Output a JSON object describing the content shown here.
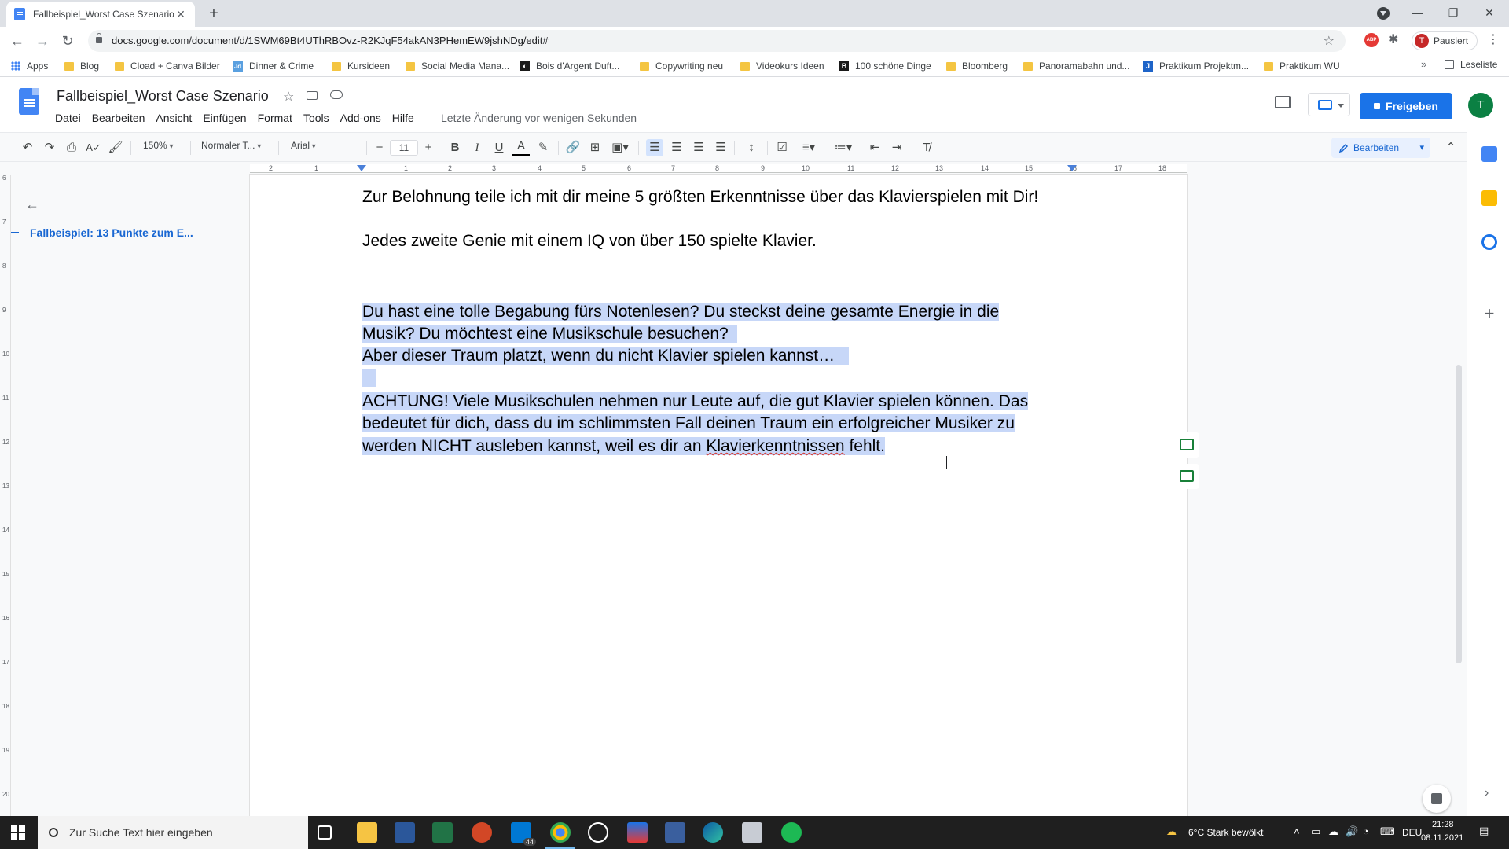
{
  "browser": {
    "tab_title": "Fallbeispiel_Worst Case Szenario",
    "tab_close": "✕",
    "new_tab": "+",
    "url": "docs.google.com/document/d/1SWM69Bt4UThRBOvz-R2KJqF54akAN3PHemEW9jshNDg/edit#",
    "profile_status": "Pausiert",
    "profile_initial": "T",
    "abp_label": "ABP"
  },
  "bookmarks": {
    "items": [
      {
        "label": "Apps"
      },
      {
        "label": "Blog"
      },
      {
        "label": "Cload + Canva Bilder"
      },
      {
        "label": "Dinner & Crime"
      },
      {
        "label": "Kursideen"
      },
      {
        "label": "Social Media Mana..."
      },
      {
        "label": "Bois d'Argent Duft..."
      },
      {
        "label": "Copywriting neu"
      },
      {
        "label": "Videokurs Ideen"
      },
      {
        "label": "100 schöne Dinge"
      },
      {
        "label": "Bloomberg"
      },
      {
        "label": "Panoramabahn und..."
      },
      {
        "label": "Praktikum Projektm..."
      },
      {
        "label": "Praktikum WU"
      }
    ],
    "more": "»",
    "reading_list": "Leseliste"
  },
  "docs": {
    "title": "Fallbeispiel_Worst Case Szenario",
    "menus": [
      "Datei",
      "Bearbeiten",
      "Ansicht",
      "Einfügen",
      "Format",
      "Tools",
      "Add-ons",
      "Hilfe"
    ],
    "last_edit": "Letzte Änderung vor wenigen Sekunden",
    "share_label": "Freigeben",
    "user_initial": "T"
  },
  "format_toolbar": {
    "zoom": "150%",
    "style": "Normaler T...",
    "font": "Arial",
    "font_size": "11",
    "minus": "−",
    "plus": "+",
    "bold": "B",
    "italic": "I",
    "underline": "U",
    "text_color": "A",
    "mode": "Bearbeiten"
  },
  "ruler": {
    "horizontal_labels": [
      "2",
      "1",
      "1",
      "2",
      "3",
      "4",
      "5",
      "6",
      "7",
      "8",
      "9",
      "10",
      "11",
      "12",
      "13",
      "14",
      "15",
      "16",
      "17",
      "18"
    ],
    "vertical_labels": [
      "6",
      "7",
      "8",
      "9",
      "10",
      "11",
      "12",
      "13",
      "14",
      "15",
      "16",
      "17",
      "18",
      "19",
      "20"
    ]
  },
  "outline": {
    "back": "←",
    "heading": "Fallbeispiel: 13 Punkte zum E..."
  },
  "document": {
    "p1": "Zur Belohnung teile ich mit dir meine 5 größten Erkenntnisse über das Klavierspielen mit Dir!",
    "p2": "Jedes zweite Genie mit einem IQ von über 150 spielte Klavier.",
    "sel_l1": "Du hast eine tolle Begabung fürs Notenlesen? Du steckst deine gesamte Energie in die",
    "sel_l2": "Musik? Du möchtest eine Musikschule besuchen?",
    "sel_l3": "Aber dieser Traum platzt, wenn du nicht Klavier spielen kannst…",
    "sel_l4": "ACHTUNG! Viele Musikschulen nehmen nur Leute auf, die gut Klavier spielen können. Das",
    "sel_l5": "bedeutet für dich, dass du im schlimmsten Fall deinen Traum ein erfolgreicher Musiker zu",
    "sel_l6_a": "werden NICHT ausleben kannst, weil es dir an ",
    "sel_l6_b": "Klavierkenntnissen",
    "sel_l6_c": " fehlt."
  },
  "taskbar": {
    "search_placeholder": "Zur Suche Text hier eingeben",
    "mail_badge": "44",
    "weather": "6°C  Stark bewölkt",
    "language": "DEU",
    "time": "21:28",
    "date": "08.11.2021"
  },
  "colors": {
    "selection": "#c7d7f8",
    "share_blue": "#1a73e8",
    "avatar_green": "#0b8043",
    "outline_blue": "#1967d2"
  }
}
